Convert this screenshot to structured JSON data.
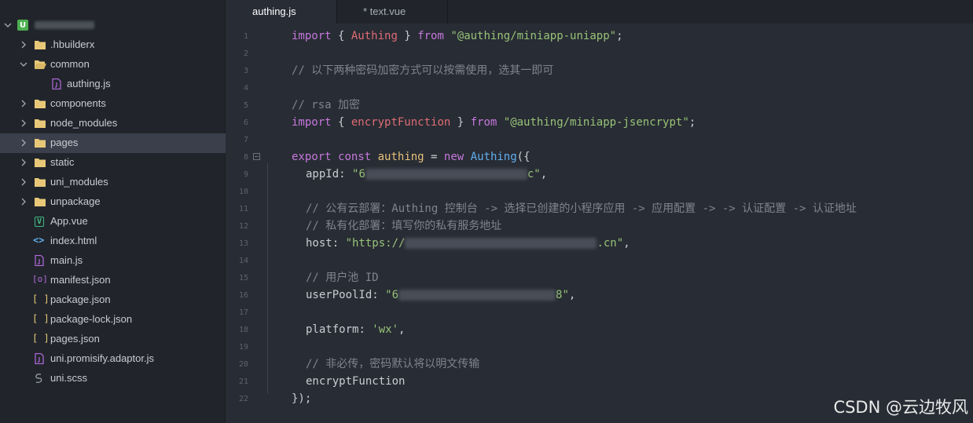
{
  "sidebar": {
    "project_icon_letter": "U",
    "items": [
      {
        "label": ".hbuilderx",
        "icon": "folder-icon",
        "expanded": false
      },
      {
        "label": "common",
        "icon": "folder-open-icon",
        "expanded": true
      },
      {
        "label": "authing.js",
        "icon": "js-file-icon"
      },
      {
        "label": "components",
        "icon": "folder-icon",
        "expanded": false
      },
      {
        "label": "node_modules",
        "icon": "folder-icon",
        "expanded": false
      },
      {
        "label": "pages",
        "icon": "folder-icon",
        "expanded": false,
        "selected": true
      },
      {
        "label": "static",
        "icon": "folder-icon",
        "expanded": false
      },
      {
        "label": "uni_modules",
        "icon": "folder-icon",
        "expanded": false
      },
      {
        "label": "unpackage",
        "icon": "folder-icon",
        "expanded": false
      },
      {
        "label": "App.vue",
        "icon": "vue-file-icon",
        "glyph": "V"
      },
      {
        "label": "index.html",
        "icon": "html-file-icon",
        "glyph": "<>"
      },
      {
        "label": "main.js",
        "icon": "js-file-icon"
      },
      {
        "label": "manifest.json",
        "icon": "manifest-file-icon",
        "glyph": "[o]"
      },
      {
        "label": "package.json",
        "icon": "json-file-icon",
        "glyph": "[ ]"
      },
      {
        "label": "package-lock.json",
        "icon": "json-file-icon",
        "glyph": "[ ]"
      },
      {
        "label": "pages.json",
        "icon": "json-file-icon",
        "glyph": "[ ]"
      },
      {
        "label": "uni.promisify.adaptor.js",
        "icon": "js-file-icon"
      },
      {
        "label": "uni.scss",
        "icon": "scss-file-icon"
      }
    ]
  },
  "tabs": [
    {
      "label": "authing.js",
      "active": true
    },
    {
      "label": "* text.vue",
      "active": false
    }
  ],
  "editor": {
    "line_numbers": [
      "1",
      "2",
      "3",
      "4",
      "5",
      "6",
      "7",
      "8",
      "9",
      "10",
      "11",
      "12",
      "13",
      "14",
      "15",
      "16",
      "17",
      "18",
      "19",
      "20",
      "21",
      "22"
    ],
    "code": {
      "l1": {
        "import": "import",
        "brace_open": " { ",
        "name": "Authing",
        "brace_close": " } ",
        "from": "from",
        "space": " ",
        "source": "\"@authing/miniapp-uniapp\"",
        "semi": ";"
      },
      "l3": {
        "comment": "// 以下两种密码加密方式可以按需使用，选其一即可"
      },
      "l5": {
        "comment": "// rsa 加密"
      },
      "l6": {
        "import": "import",
        "brace_open": " { ",
        "name": "encryptFunction",
        "brace_close": " } ",
        "from": "from",
        "space": " ",
        "source": "\"@authing/miniapp-jsencrypt\"",
        "semi": ";"
      },
      "l8": {
        "export": "export",
        "const": "const",
        "var": "authing",
        "eq": " = ",
        "new": "new",
        "cls": "Authing",
        "open": "({"
      },
      "l9": {
        "key": "appId",
        "colon": ": ",
        "val_start": "\"6",
        "val_end": "c\"",
        "comma": ","
      },
      "l11": {
        "comment": "// 公有云部署：Authing 控制台 -> 选择已创建的小程序应用 -> 应用配置 -> -> 认证配置 -> 认证地址"
      },
      "l12": {
        "comment": "// 私有化部署：填写你的私有服务地址"
      },
      "l13": {
        "key": "host",
        "colon": ": ",
        "val_start": "\"https://",
        "val_end": ".cn\"",
        "comma": ","
      },
      "l15": {
        "comment": "// 用户池 ID"
      },
      "l16": {
        "key": "userPoolId",
        "colon": ": ",
        "val_start": "\"6",
        "val_end": "8\"",
        "comma": ","
      },
      "l18": {
        "key": "platform",
        "colon": ": ",
        "val": "'wx'",
        "comma": ","
      },
      "l20": {
        "comment": "// 非必传，密码默认将以明文传输"
      },
      "l21": {
        "text": "encryptFunction"
      },
      "l22": {
        "text": "});"
      }
    }
  },
  "watermark": "CSDN @云边牧风",
  "colors": {
    "keyword": "#c678dd",
    "import_name": "#e06c75",
    "string": "#98c379",
    "comment": "#7f848e",
    "class": "#61afef",
    "variable": "#e5c07b",
    "folder": "#e8c878",
    "js_icon": "#b36be0",
    "vue_icon": "#42b883",
    "html_icon": "#61afef"
  }
}
